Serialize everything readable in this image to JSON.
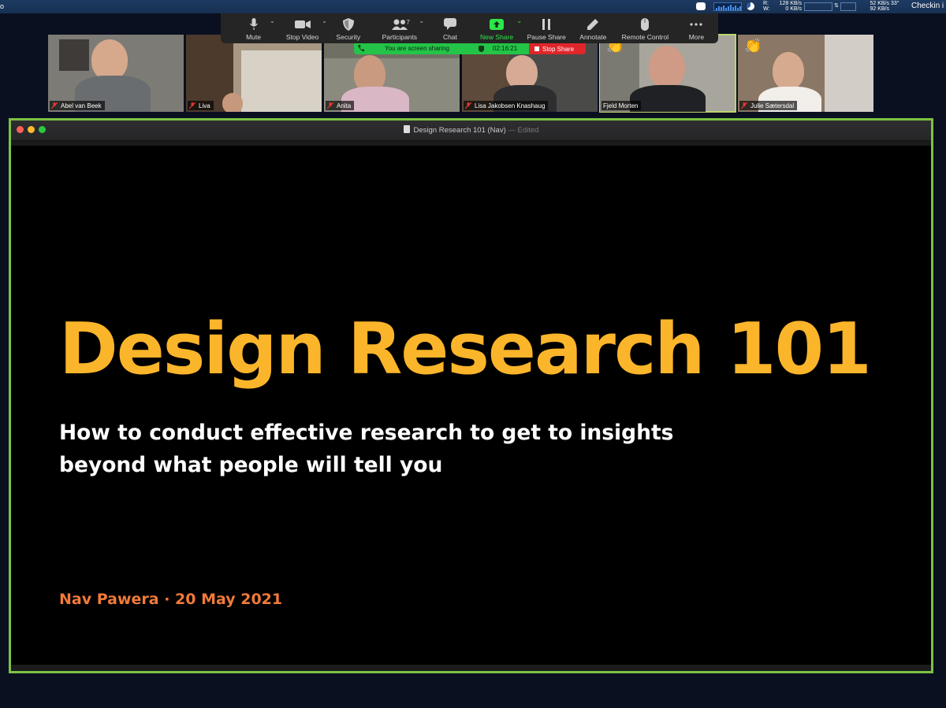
{
  "menubar": {
    "left_glyph": "o",
    "net_labels": "R:\nW:",
    "net_read": "128 KB/s",
    "net_write": "0 KB/s",
    "disk_read": "52 KB/s",
    "disk_write": "92 KB/s",
    "temperature": "33°",
    "app_label": "Checkin i"
  },
  "toolbar": {
    "items": [
      {
        "label": "Mute",
        "icon": "microphone-icon"
      },
      {
        "label": "Stop Video",
        "icon": "video-camera-icon"
      },
      {
        "label": "Security",
        "icon": "shield-icon"
      },
      {
        "label": "Participants",
        "icon": "participants-icon",
        "count": "7"
      },
      {
        "label": "Chat",
        "icon": "chat-bubble-icon"
      },
      {
        "label": "New Share",
        "icon": "share-arrow-icon"
      },
      {
        "label": "Pause Share",
        "icon": "pause-icon"
      },
      {
        "label": "Annotate",
        "icon": "pencil-icon"
      },
      {
        "label": "Remote Control",
        "icon": "mouse-icon"
      },
      {
        "label": "More",
        "icon": "more-dots-icon"
      }
    ],
    "accent": "#2ee54a"
  },
  "sharing": {
    "status": "You are screen sharing",
    "timer": "02:16:21",
    "stop_label": "Stop Share",
    "banner_color": "#23c447",
    "stop_color": "#e0262b"
  },
  "participants": [
    {
      "name": "Abel van Beek"
    },
    {
      "name": "Liva"
    },
    {
      "name": "Anita"
    },
    {
      "name": "Lisa Jakobsen Knashaug"
    },
    {
      "name": "Fjeld Morten",
      "reaction": "👏"
    },
    {
      "name": "Julie Sætersdal",
      "reaction": "👏"
    }
  ],
  "shared_window": {
    "title": "Design Research 101 (Nav)",
    "status": "— Edited",
    "frame_color": "#7dc242"
  },
  "slide": {
    "title": "Design Research 101",
    "subtitle_line1": "How to conduct effective research to get to insights",
    "subtitle_line2": "beyond what people will tell you",
    "author_line": "Nav Pawera · 20 May 2021",
    "title_color": "#fbb52a",
    "author_color": "#f07a3a"
  }
}
